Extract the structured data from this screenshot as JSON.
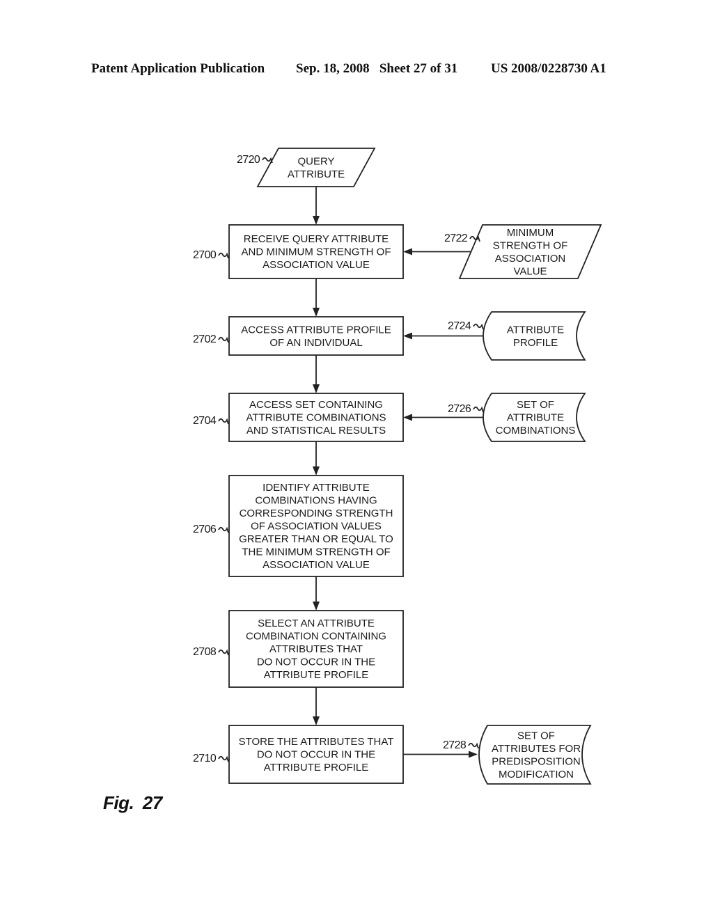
{
  "header": {
    "publication": "Patent Application Publication",
    "date_sheet": "Sep. 18, 2008   Sheet 27 of 31",
    "patent_number": "US 2008/0228730 A1"
  },
  "figure_label": "Fig. 27",
  "nodes": [
    {
      "id": "2720",
      "ref": "2720",
      "type": "input-parallelogram",
      "lines": [
        "QUERY",
        "ATTRIBUTE"
      ]
    },
    {
      "id": "2700",
      "ref": "2700",
      "type": "process",
      "lines": [
        "RECEIVE QUERY ATTRIBUTE",
        "AND MINIMUM STRENGTH OF",
        "ASSOCIATION VALUE"
      ]
    },
    {
      "id": "2722",
      "ref": "2722",
      "type": "input-parallelogram",
      "lines": [
        "MINIMUM",
        "STRENGTH OF",
        "ASSOCIATION",
        "VALUE"
      ]
    },
    {
      "id": "2702",
      "ref": "2702",
      "type": "process",
      "lines": [
        "ACCESS ATTRIBUTE PROFILE",
        "OF AN INDIVIDUAL"
      ]
    },
    {
      "id": "2724",
      "ref": "2724",
      "type": "stored-data",
      "lines": [
        "ATTRIBUTE",
        "PROFILE"
      ]
    },
    {
      "id": "2704",
      "ref": "2704",
      "type": "process",
      "lines": [
        "ACCESS SET CONTAINING",
        "ATTRIBUTE COMBINATIONS",
        "AND STATISTICAL RESULTS"
      ]
    },
    {
      "id": "2726",
      "ref": "2726",
      "type": "stored-data",
      "lines": [
        "SET OF",
        "ATTRIBUTE",
        "COMBINATIONS"
      ]
    },
    {
      "id": "2706",
      "ref": "2706",
      "type": "process",
      "lines": [
        "IDENTIFY ATTRIBUTE",
        "COMBINATIONS HAVING",
        "CORRESPONDING STRENGTH",
        "OF ASSOCIATION VALUES",
        "GREATER THAN OR EQUAL TO",
        "THE MINIMUM STRENGTH OF",
        "ASSOCIATION VALUE"
      ]
    },
    {
      "id": "2708",
      "ref": "2708",
      "type": "process",
      "lines": [
        "SELECT AN ATTRIBUTE",
        "COMBINATION CONTAINING",
        "ATTRIBUTES THAT",
        "DO NOT OCCUR IN THE",
        "ATTRIBUTE PROFILE"
      ]
    },
    {
      "id": "2710",
      "ref": "2710",
      "type": "process",
      "lines": [
        "STORE THE ATTRIBUTES THAT",
        "DO NOT OCCUR IN THE",
        "ATTRIBUTE PROFILE"
      ]
    },
    {
      "id": "2728",
      "ref": "2728",
      "type": "stored-data",
      "lines": [
        "SET OF",
        "ATTRIBUTES FOR",
        "PREDISPOSITION",
        "MODIFICATION"
      ]
    }
  ],
  "edges": [
    {
      "from": "2720",
      "to": "2700"
    },
    {
      "from": "2722",
      "to": "2700"
    },
    {
      "from": "2700",
      "to": "2702"
    },
    {
      "from": "2724",
      "to": "2702"
    },
    {
      "from": "2702",
      "to": "2704"
    },
    {
      "from": "2726",
      "to": "2704"
    },
    {
      "from": "2704",
      "to": "2706"
    },
    {
      "from": "2706",
      "to": "2708"
    },
    {
      "from": "2708",
      "to": "2710"
    },
    {
      "from": "2710",
      "to": "2728"
    }
  ]
}
